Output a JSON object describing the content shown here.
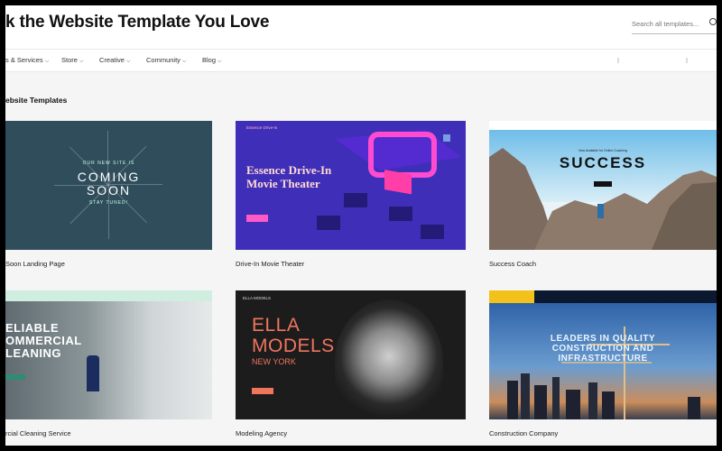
{
  "header": {
    "title": "k the Website Template You Love",
    "search_placeholder": "Search all templates..."
  },
  "nav": {
    "items": [
      {
        "label": "s & Services"
      },
      {
        "label": "Store"
      },
      {
        "label": "Creative"
      },
      {
        "label": "Community"
      },
      {
        "label": "Blog"
      }
    ]
  },
  "section": {
    "title": "ebsite Templates"
  },
  "templates": [
    {
      "label": "Soon Landing Page",
      "preview": {
        "kicker": "OUR NEW SITE IS",
        "headline_1": "COMING",
        "headline_2": "SOON",
        "sub": "STAY TUNED!"
      }
    },
    {
      "label": "Drive-In Movie Theater",
      "preview": {
        "brand": "Essence Drive-In",
        "title_1": "Essence Drive-In",
        "title_2": "Movie Theater"
      }
    },
    {
      "label": "Success Coach",
      "preview": {
        "title": "SUCCESS",
        "sub": "Now Available for Online Coaching"
      }
    },
    {
      "label": "rcial Cleaning Service",
      "preview": {
        "line_1": "ELIABLE",
        "line_2": "OMMERCIAL",
        "line_3": "LEANING"
      }
    },
    {
      "label": "Modeling Agency",
      "preview": {
        "logo": "ELLA MODELS",
        "line_1": "ELLA",
        "line_2": "MODELS",
        "line_3": "NEW YORK"
      }
    },
    {
      "label": "Construction Company",
      "preview": {
        "line_1": "LEADERS IN QUALITY",
        "line_2": "CONSTRUCTION AND",
        "line_3": "INFRASTRUCTURE"
      }
    }
  ],
  "colors": {
    "coming_soon_bg": "#2f4d5b",
    "drive_in_bg": "#3f2fb8",
    "drive_in_accent": "#ff58c7",
    "ella_accent": "#f0755d",
    "cleaning_accent": "#2e8c72",
    "construction_logo": "#f2c21b"
  }
}
